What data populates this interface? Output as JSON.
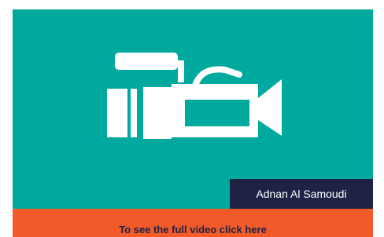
{
  "video": {
    "icon": "video-camera-icon",
    "author": "Adnan Al Samoudi"
  },
  "cta": {
    "label": "To see the full video click here"
  },
  "colors": {
    "panel_teal": "#00a99d",
    "badge_navy": "#1e2346",
    "cta_orange": "#f15a29",
    "icon_white": "#ffffff"
  }
}
